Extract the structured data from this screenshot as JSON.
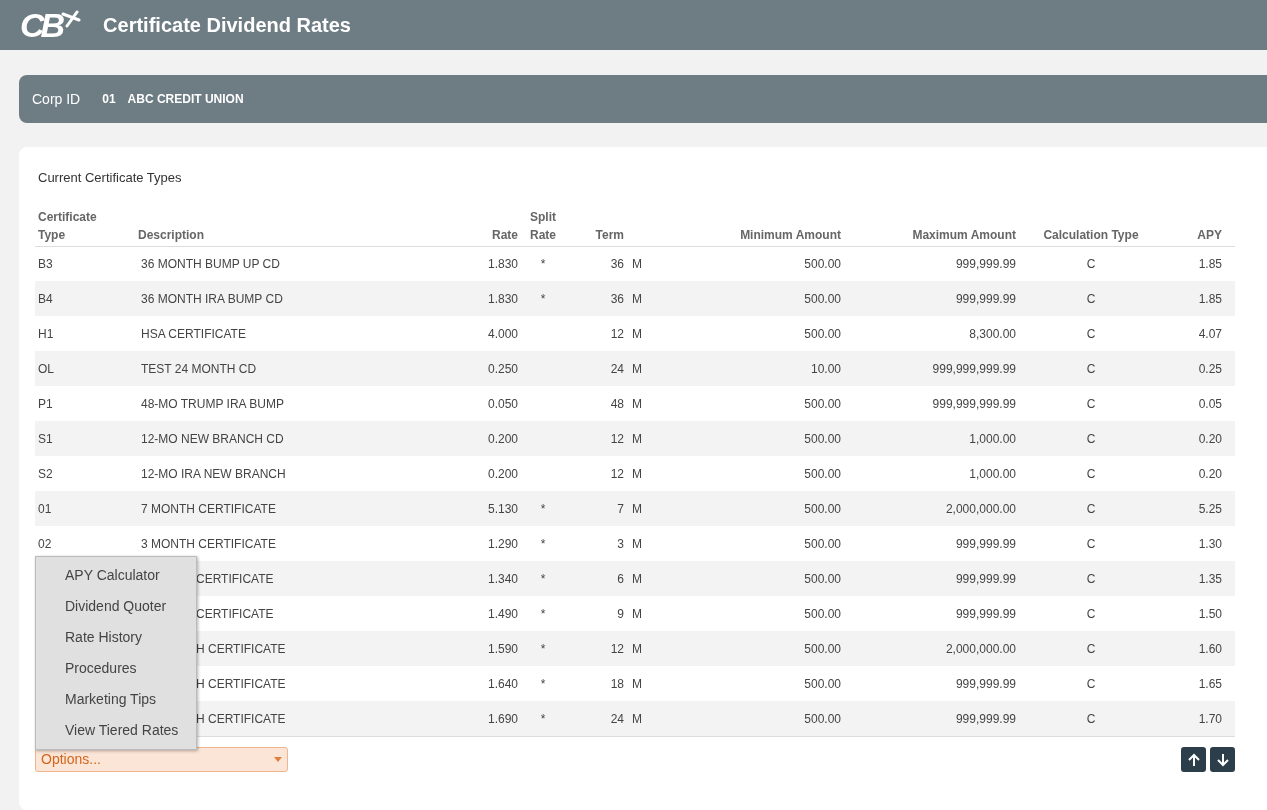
{
  "header": {
    "logo": "CB",
    "title": "Certificate Dividend Rates"
  },
  "corp": {
    "label": "Corp ID",
    "id": "01",
    "name": "ABC CREDIT UNION"
  },
  "section_title": "Current Certificate Types",
  "table": {
    "columns": [
      {
        "line1": "Certificate",
        "line2": "Type"
      },
      {
        "line2": "Description"
      },
      {
        "line2": "Rate"
      },
      {
        "line1": "Split",
        "line2": "Rate"
      },
      {
        "line2": "Term"
      },
      {
        "line2": "Minimum Amount"
      },
      {
        "line2": "Maximum Amount"
      },
      {
        "line2": "Calculation Type"
      },
      {
        "line2": "APY"
      }
    ],
    "rows": [
      {
        "type": "B3",
        "description": "36 MONTH BUMP UP CD",
        "rate": "1.830",
        "split_rate": "*",
        "term": "36",
        "unit": "M",
        "min": "500.00",
        "max": "999,999.99",
        "calc": "C",
        "apy": "1.85",
        "covered": false
      },
      {
        "type": "B4",
        "description": "36 MONTH IRA BUMP CD",
        "rate": "1.830",
        "split_rate": "*",
        "term": "36",
        "unit": "M",
        "min": "500.00",
        "max": "999,999.99",
        "calc": "C",
        "apy": "1.85",
        "covered": false
      },
      {
        "type": "H1",
        "description": "HSA CERTIFICATE",
        "rate": "4.000",
        "term": "12",
        "unit": "M",
        "min": "500.00",
        "max": "8,300.00",
        "calc": "C",
        "apy": "4.07",
        "covered": false
      },
      {
        "type": "OL",
        "description": "TEST 24 MONTH CD",
        "rate": "0.250",
        "term": "24",
        "unit": "M",
        "min": "10.00",
        "max": "999,999,999.99",
        "calc": "C",
        "apy": "0.25",
        "covered": false
      },
      {
        "type": "P1",
        "description": "48-MO TRUMP IRA BUMP",
        "rate": "0.050",
        "term": "48",
        "unit": "M",
        "min": "500.00",
        "max": "999,999,999.99",
        "calc": "C",
        "apy": "0.05",
        "covered": false
      },
      {
        "type": "S1",
        "description": "12-MO NEW BRANCH CD",
        "rate": "0.200",
        "term": "12",
        "unit": "M",
        "min": "500.00",
        "max": "1,000.00",
        "calc": "C",
        "apy": "0.20",
        "covered": false
      },
      {
        "type": "S2",
        "description": "12-MO IRA NEW BRANCH",
        "rate": "0.200",
        "term": "12",
        "unit": "M",
        "min": "500.00",
        "max": "1,000.00",
        "calc": "C",
        "apy": "0.20",
        "covered": false
      },
      {
        "type": "01",
        "description": "7 MONTH CERTIFICATE",
        "rate": "5.130",
        "split_rate": "*",
        "term": "7",
        "unit": "M",
        "min": "500.00",
        "max": "2,000,000.00",
        "calc": "C",
        "apy": "5.25",
        "covered": false
      },
      {
        "type": "02",
        "description": "3 MONTH CERTIFICATE",
        "rate": "1.290",
        "split_rate": "*",
        "term": "3",
        "unit": "M",
        "min": "500.00",
        "max": "999,999.99",
        "calc": "C",
        "apy": "1.30",
        "covered": false
      },
      {
        "description": "CERTIFICATE",
        "rate": "1.340",
        "split_rate": "*",
        "term": "6",
        "unit": "M",
        "min": "500.00",
        "max": "999,999.99",
        "calc": "C",
        "apy": "1.35",
        "covered": true
      },
      {
        "description": "CERTIFICATE",
        "rate": "1.490",
        "split_rate": "*",
        "term": "9",
        "unit": "M",
        "min": "500.00",
        "max": "999,999.99",
        "calc": "C",
        "apy": "1.50",
        "covered": true
      },
      {
        "description": "H CERTIFICATE",
        "rate": "1.590",
        "split_rate": "*",
        "term": "12",
        "unit": "M",
        "min": "500.00",
        "max": "2,000,000.00",
        "calc": "C",
        "apy": "1.60",
        "covered": true
      },
      {
        "description": "H CERTIFICATE",
        "rate": "1.640",
        "split_rate": "*",
        "term": "18",
        "unit": "M",
        "min": "500.00",
        "max": "999,999.99",
        "calc": "C",
        "apy": "1.65",
        "covered": true
      },
      {
        "description": "H CERTIFICATE",
        "rate": "1.690",
        "split_rate": "*",
        "term": "24",
        "unit": "M",
        "min": "500.00",
        "max": "999,999.99",
        "calc": "C",
        "apy": "1.70",
        "covered": true
      }
    ]
  },
  "options_menu": {
    "expanded": true,
    "items": [
      "APY Calculator",
      "Dividend Quoter",
      "Rate History",
      "Procedures",
      "Marketing Tips",
      "View Tiered Rates"
    ]
  },
  "options_select": {
    "placeholder": "Options..."
  }
}
